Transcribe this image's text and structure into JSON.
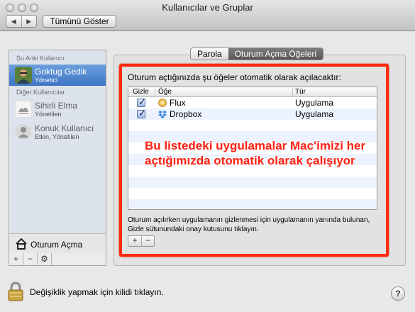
{
  "window": {
    "title": "Kullanıcılar ve Gruplar",
    "show_all": "Tümünü Göster",
    "back_glyph": "◀",
    "forward_glyph": "▶"
  },
  "sidebar": {
    "current_header": "Şu Anki Kullanıcı",
    "other_header": "Diğer Kullanıcılar",
    "users": [
      {
        "name": "Goktug Gedik",
        "role": "Yönetici",
        "selected": true
      },
      {
        "name": "Sihirli Elma",
        "role": "Yönetilen",
        "selected": false
      },
      {
        "name": "Konuk Kullanıcı",
        "role": "Etkin, Yönetilen",
        "selected": false
      }
    ],
    "login_options": "Oturum Açma",
    "buttons": {
      "add": "+",
      "remove": "−",
      "gear": "⚙"
    }
  },
  "tabs": [
    {
      "label": "Parola",
      "active": false
    },
    {
      "label": "Oturum Açma Öğeleri",
      "active": true
    }
  ],
  "panel": {
    "intro": "Oturum açtığınızda şu öğeler otomatik olarak açılacaktır:",
    "columns": {
      "hide": "Gizle",
      "item": "Öğe",
      "type": "Tür"
    },
    "items": [
      {
        "name": "Flux",
        "type": "Uygulama",
        "hidden": true
      },
      {
        "name": "Dropbox",
        "type": "Uygulama",
        "hidden": true
      }
    ],
    "help_text": "Oturum açılırken uygulamanın gizlenmesi için uygulamanın yanında bulunan, Gizle sütunundaki onay kutusunu tıklayın.",
    "add": "+",
    "remove": "−"
  },
  "annotation": "Bu listedeki uygulamalar Mac'imizi her açtığımızda otomatik olarak çalışıyor",
  "footer": {
    "lock_text": "Değişiklik yapmak için kilidi tıklayın.",
    "help": "?"
  },
  "colors": {
    "highlight": "#ff2a0c",
    "selection": "#3e74c4"
  }
}
